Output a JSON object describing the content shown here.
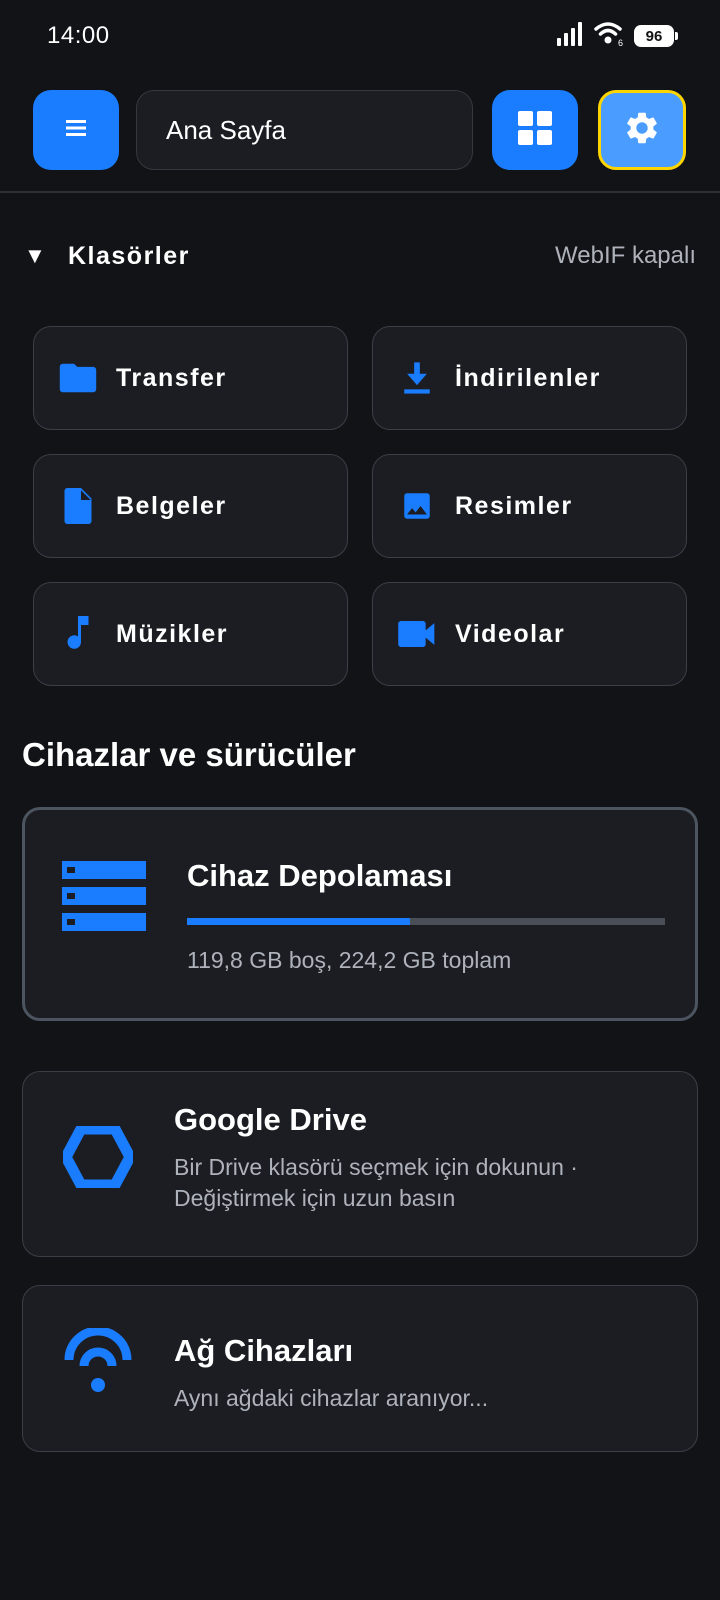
{
  "status_bar": {
    "time": "14:00",
    "battery": "96",
    "icons": [
      "signal-icon",
      "wifi-icon",
      "battery-icon"
    ]
  },
  "toolbar": {
    "title": "Ana Sayfa",
    "icons": [
      "menu-icon",
      "grid-view-icon",
      "settings-icon"
    ]
  },
  "folders_section": {
    "title": "Klasörler",
    "webif_status": "WebIF kapalı",
    "items": [
      {
        "label": "Transfer",
        "icon": "folder-icon"
      },
      {
        "label": "İndirilenler",
        "icon": "download-icon"
      },
      {
        "label": "Belgeler",
        "icon": "document-icon"
      },
      {
        "label": "Resimler",
        "icon": "image-icon"
      },
      {
        "label": "Müzikler",
        "icon": "music-note-icon"
      },
      {
        "label": "Videolar",
        "icon": "video-camera-icon"
      }
    ]
  },
  "devices_section": {
    "title": "Cihazlar ve sürücüler",
    "storage": {
      "title": "Cihaz Depolaması",
      "subtitle": "119,8 GB boş, 224,2 GB toplam",
      "used_fraction": 0.466,
      "icon": "storage-icon"
    },
    "google_drive": {
      "title": "Google Drive",
      "subtitle_line1": "Bir Drive klasörü seçmek için dokunun ·",
      "subtitle_line2": "Değiştirmek için uzun basın",
      "icon": "google-drive-icon"
    },
    "network": {
      "title": "Ağ Cihazları",
      "subtitle": "Aynı ağdaki cihazlar aranıyor...",
      "icon": "network-wifi-icon"
    }
  },
  "colors": {
    "background": "#121316",
    "card": "#1b1d22",
    "accent": "#1a7cff",
    "settings_highlight": "#ffd500",
    "muted_text": "#aeb2bb"
  }
}
